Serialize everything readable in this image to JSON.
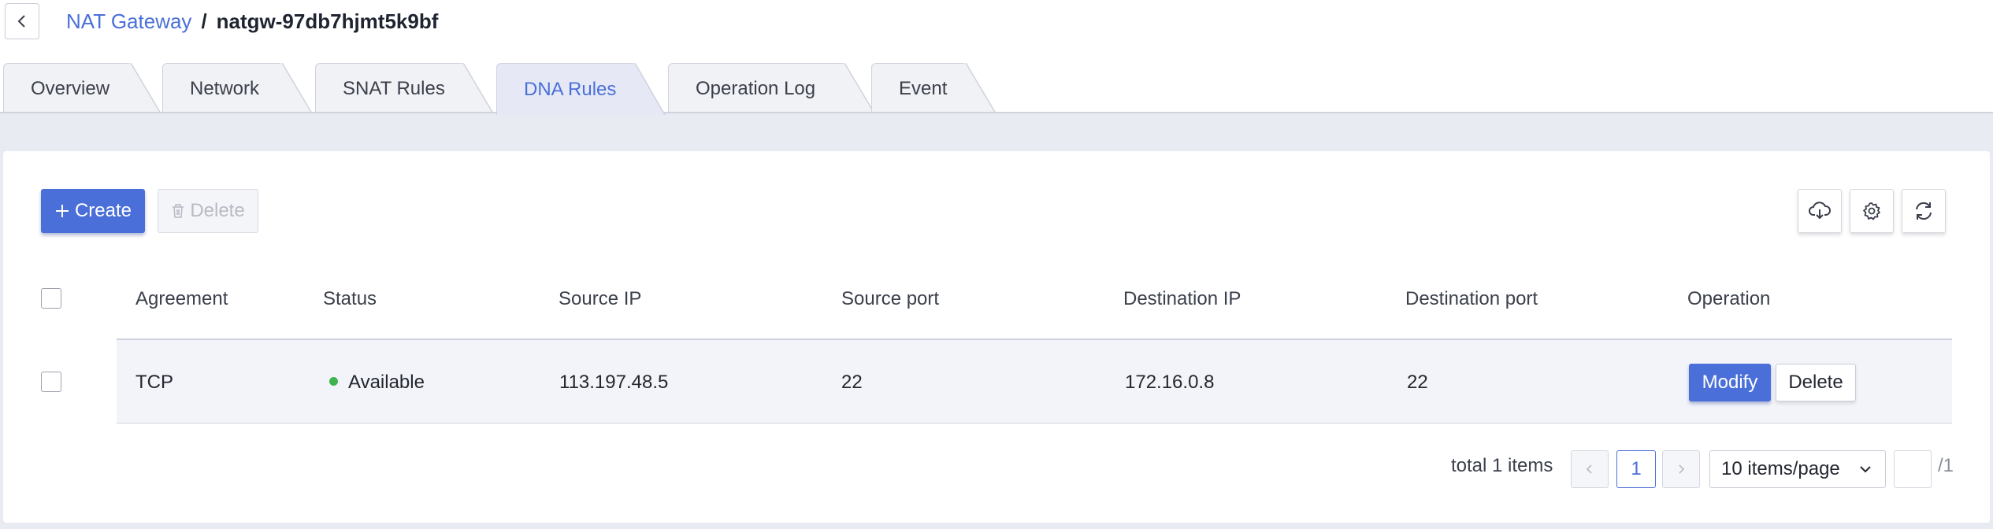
{
  "breadcrumb": {
    "parent": "NAT Gateway",
    "separator": "/",
    "current": "natgw-97db7hjmt5k9bf"
  },
  "tabs": [
    {
      "label": "Overview",
      "active": false
    },
    {
      "label": "Network",
      "active": false
    },
    {
      "label": "SNAT Rules",
      "active": false
    },
    {
      "label": "DNA Rules",
      "active": true
    },
    {
      "label": "Operation Log",
      "active": false
    },
    {
      "label": "Event",
      "active": false
    }
  ],
  "toolbar": {
    "create_label": "Create",
    "delete_label": "Delete",
    "icons": [
      "cloud-download-icon",
      "gear-icon",
      "refresh-icon"
    ]
  },
  "table": {
    "columns": [
      "Agreement",
      "Status",
      "Source IP",
      "Source port",
      "Destination IP",
      "Destination port",
      "Operation"
    ],
    "rows": [
      {
        "agreement": "TCP",
        "status": "Available",
        "source_ip": "113.197.48.5",
        "source_port": "22",
        "destination_ip": "172.16.0.8",
        "destination_port": "22",
        "actions": {
          "modify": "Modify",
          "delete": "Delete"
        }
      }
    ]
  },
  "pagination": {
    "total": "total 1 items",
    "current_page": "1",
    "page_size": "10 items/page",
    "total_pages": "/1"
  },
  "colors": {
    "accent": "#4a6fd8",
    "status_available": "#3fb34f",
    "background": "#e9ebf2"
  }
}
